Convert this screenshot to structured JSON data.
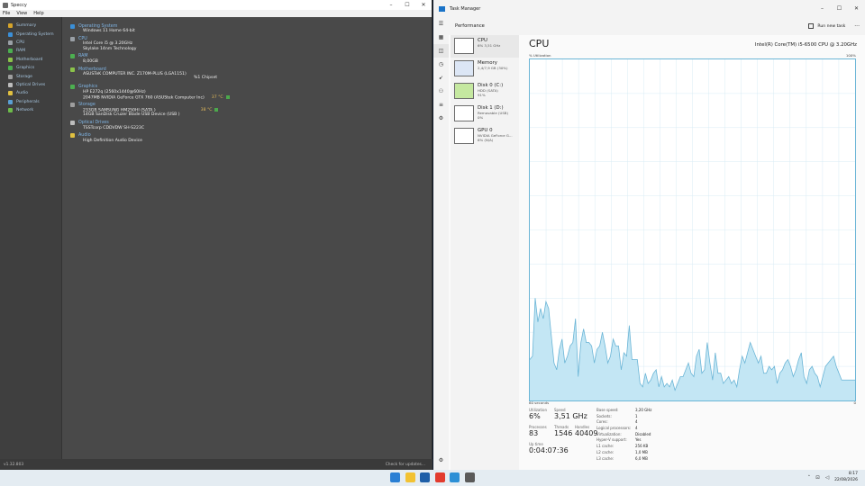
{
  "speccy": {
    "menu": [
      "File",
      "View",
      "Help"
    ],
    "nav": [
      {
        "label": "Summary",
        "color": "#d6a42a"
      },
      {
        "label": "Operating System",
        "color": "#3a8fd8"
      },
      {
        "label": "CPU",
        "color": "#9aa0a6"
      },
      {
        "label": "RAM",
        "color": "#4caf50"
      },
      {
        "label": "Motherboard",
        "color": "#8bc34a"
      },
      {
        "label": "Graphics",
        "color": "#4caf50"
      },
      {
        "label": "Storage",
        "color": "#9e9e9e"
      },
      {
        "label": "Optical Drives",
        "color": "#bdbdbd"
      },
      {
        "label": "Audio",
        "color": "#e0c040"
      },
      {
        "label": "Peripherals",
        "color": "#5a9fd4"
      },
      {
        "label": "Network",
        "color": "#6dbb4a"
      }
    ],
    "sections": {
      "os": {
        "title": "Operating System",
        "lines": [
          "Windows 11 Home 64-bit"
        ]
      },
      "cpu": {
        "title": "CPU",
        "lines": [
          "Intel Core i5 @ 3.20GHz",
          "Skylake 14nm Technology"
        ]
      },
      "ram": {
        "title": "RAM",
        "lines": [
          "8,00GB"
        ]
      },
      "mb": {
        "title": "Motherboard",
        "lines": [
          "ASUSTeK COMPUTER INC. Z170M-PLUS (LGA1151)"
        ],
        "chipset": "%1 Chipset"
      },
      "gfx": {
        "title": "Graphics",
        "lines": [
          "HP E272q (2560x1440@60Hz)",
          "2047MB NVIDIA GeForce GTX 760 (ASUStek Computer Inc)"
        ],
        "temp": "37 °C"
      },
      "storage": {
        "title": "Storage",
        "lines": [
          "233GB SAMSUNG HM250HI (SATA )",
          "14GB SanDisk Cruzer Blade USB Device (USB )"
        ],
        "temp": "38 °C"
      },
      "optical": {
        "title": "Optical Drives",
        "lines": [
          "TSSTcorp CDDVDW SH-S223C"
        ]
      },
      "audio": {
        "title": "Audio",
        "lines": [
          "High Definition Audio Device"
        ]
      }
    },
    "version": "v1.32.803",
    "update": "Check for updates..."
  },
  "taskmanager": {
    "title": "Task Manager",
    "page": "Performance",
    "run_new_task": "Run new task",
    "devices": [
      {
        "name": "CPU",
        "sub": "6% 3,51 GHz",
        "sub2": "",
        "thumb": "#ffffff"
      },
      {
        "name": "Memory",
        "sub": "2,4/7,9 GB (30%)",
        "sub2": "",
        "thumb": "#dce6f5"
      },
      {
        "name": "Disk 0 (C:)",
        "sub": "HDD (SATA)",
        "sub2": "91%",
        "thumb": "#c5e8a0"
      },
      {
        "name": "Disk 1 (D:)",
        "sub": "Removable (USB)",
        "sub2": "0%",
        "thumb": "#ffffff"
      },
      {
        "name": "GPU 0",
        "sub": "NVIDIA GeForce G...",
        "sub2": "6% (N/A)",
        "thumb": "#ffffff"
      }
    ],
    "cpu_title": "CPU",
    "cpu_name": "Intel(R) Core(TM) i5-6500 CPU @ 3.20GHz",
    "util_label": "% Utilization",
    "util_max": "100%",
    "time_label": "60 seconds",
    "time_end": "0",
    "stats": {
      "utilization": {
        "k": "Utilization",
        "v": "6%"
      },
      "speed": {
        "k": "Speed",
        "v": "3,51 GHz"
      },
      "processes": {
        "k": "Processes",
        "v": "83"
      },
      "threads": {
        "k": "Threads",
        "v": "1546"
      },
      "handles": {
        "k": "Handles",
        "v": "40409"
      },
      "uptime": {
        "k": "Up time",
        "v": "0:04:07:36"
      }
    },
    "details": [
      {
        "k": "Base speed:",
        "v": "3,20 GHz"
      },
      {
        "k": "Sockets:",
        "v": "1"
      },
      {
        "k": "Cores:",
        "v": "4"
      },
      {
        "k": "Logical processors:",
        "v": "4"
      },
      {
        "k": "Virtualization:",
        "v": "Disabled"
      },
      {
        "k": "Hyper-V support:",
        "v": "Yes"
      },
      {
        "k": "L1 cache:",
        "v": "256 KB"
      },
      {
        "k": "L2 cache:",
        "v": "1,0 MB"
      },
      {
        "k": "L3 cache:",
        "v": "6,0 MB"
      }
    ],
    "graph_color": "#6bb5d6",
    "graph_fill": "#c3e6f4",
    "cpu_history": [
      12,
      13,
      30,
      23,
      27,
      24,
      29,
      27,
      19,
      11,
      9,
      15,
      18,
      11,
      13,
      16,
      17,
      24,
      7,
      17,
      21,
      17,
      17,
      16,
      11,
      15,
      16,
      20,
      16,
      11,
      13,
      18,
      16,
      16,
      9,
      14,
      13,
      22,
      12,
      12,
      12,
      5,
      4,
      8,
      5,
      6,
      8,
      9,
      4,
      7,
      4,
      5,
      4,
      6,
      3,
      5,
      7,
      7,
      9,
      11,
      8,
      7,
      13,
      15,
      8,
      9,
      17,
      11,
      6,
      14,
      8,
      8,
      5,
      6,
      7,
      5,
      6,
      4,
      9,
      13,
      11,
      14,
      17,
      15,
      13,
      11,
      13,
      8,
      8,
      10,
      9,
      10,
      5,
      8,
      9,
      11,
      12,
      10,
      7,
      9,
      12,
      14,
      7,
      5,
      9,
      10,
      8,
      7,
      4,
      7,
      10,
      11,
      12,
      13,
      10,
      8,
      6,
      6,
      6,
      6,
      6,
      6
    ]
  },
  "taskbar": {
    "apps": [
      {
        "name": "start",
        "color": "#2a7fd4"
      },
      {
        "name": "file-explorer",
        "color": "#f2c233"
      },
      {
        "name": "store",
        "color": "#1e5fa8"
      },
      {
        "name": "app-red",
        "color": "#e23b2e"
      },
      {
        "name": "task-manager",
        "color": "#2b8fd6"
      },
      {
        "name": "speccy",
        "color": "#5a5a5a"
      }
    ],
    "time": "8:17",
    "date": "22/08/2026"
  }
}
